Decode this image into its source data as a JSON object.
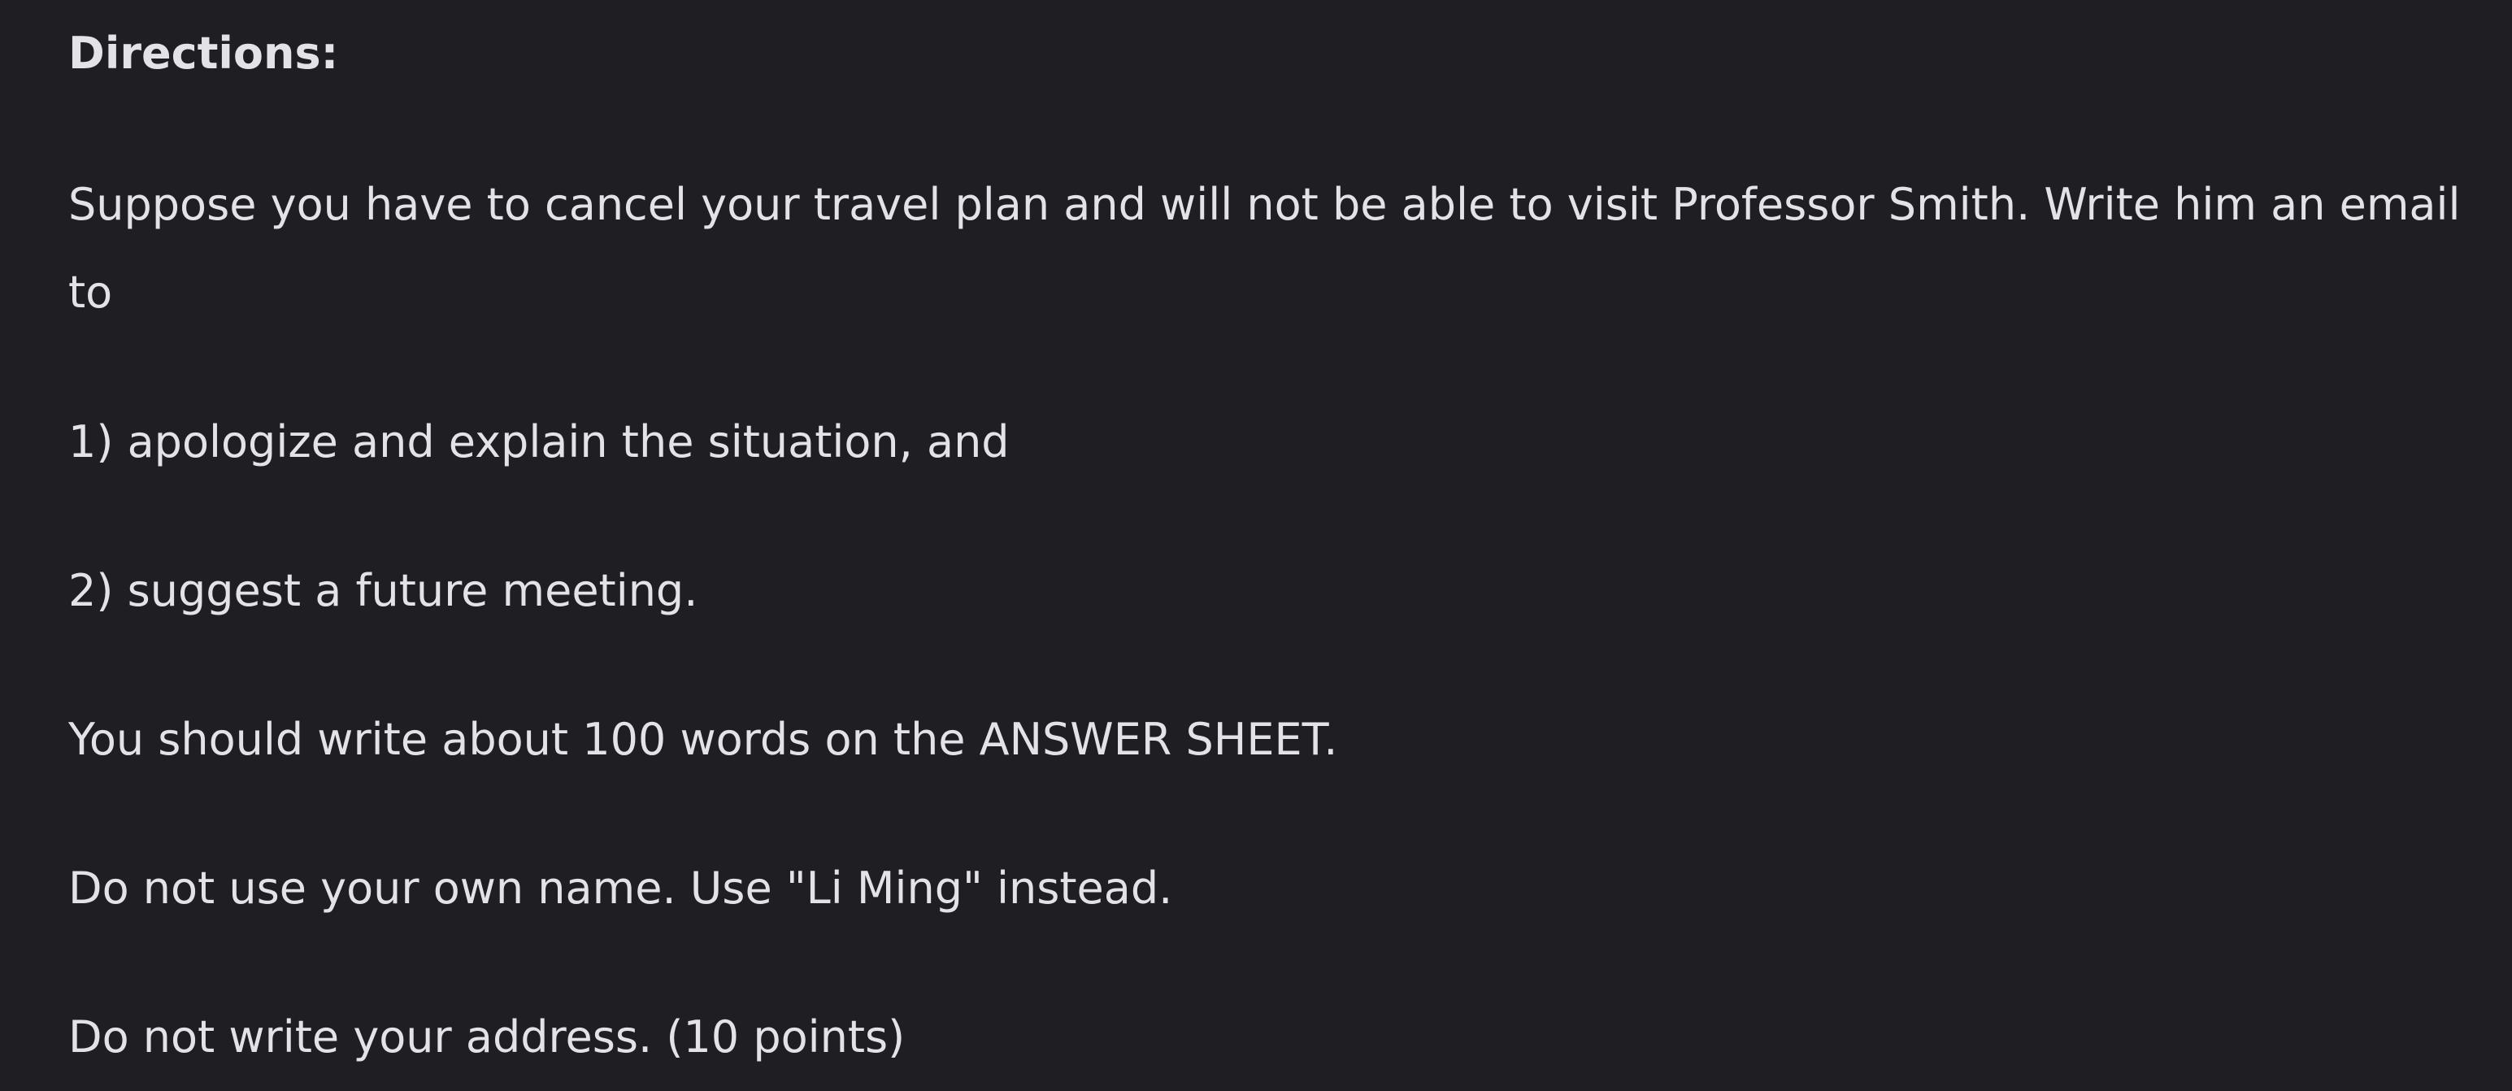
{
  "document": {
    "heading": "Directions:",
    "paragraphs": [
      "Suppose you have to cancel your travel plan and will not be able to visit Professor Smith. Write him an email",
      "to",
      "1) apologize and explain the situation, and",
      "2) suggest a future meeting.",
      "You should write about 100 words on the ANSWER SHEET.",
      "Do not use your own name. Use \"Li Ming\" instead.",
      "Do not write your address. (10 points)"
    ]
  },
  "colors": {
    "background": "#1f1e23",
    "text": "#e3e2e6"
  }
}
